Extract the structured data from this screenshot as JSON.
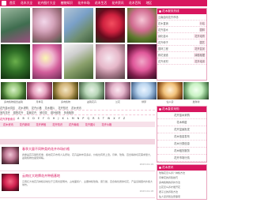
{
  "nav": {
    "items": [
      "首页",
      "花木大全",
      "花卉图片大全",
      "植物知识",
      "花卉市场",
      "花木生活",
      "花卉资讯",
      "花木百科",
      "地区"
    ]
  },
  "gallery": {
    "captions": [
      "",
      "",
      "",
      "",
      "",
      "",
      "",
      "",
      "",
      ""
    ]
  },
  "side_box": {
    "title": "花木服务热线",
    "rows": [
      {
        "left": "云南曲靖花卉市场",
        "right": ""
      },
      {
        "left": "花木直销",
        "right": "分站"
      },
      {
        "left": "花卉苗木",
        "right": "园林"
      },
      {
        "left": "绿化苗木",
        "right": "花卉培育"
      },
      {
        "left": "花卉种子",
        "right": "园艺"
      },
      {
        "left": "园林工程",
        "right": "花卉盆景"
      },
      {
        "left": "鲜花速递",
        "right": "绿植租摆"
      },
      {
        "left": "花卉资材",
        "right": "花卉培训"
      }
    ]
  },
  "thumbs": {
    "captions": [
      "多肉植物组合盆栽",
      "月季花",
      "多肉植物",
      "盆栽花卉",
      "兰花",
      "绿萝",
      "仙人掌",
      "发财树"
    ]
  },
  "links": {
    "line1": [
      "花卉苗木供应",
      "花木求购",
      "花卉价格",
      "花木图片",
      "花卉知识",
      "花木资讯"
    ],
    "line2": [
      "室内花卉",
      "庭院花卉",
      "盆栽花卉",
      "鲜切花",
      "观叶植物",
      "多肉植物"
    ],
    "alpha_label": "花卉拼音索引",
    "letters": [
      "A",
      "B",
      "C",
      "D",
      "E",
      "F",
      "G",
      "H",
      "J",
      "K",
      "L",
      "M",
      "N",
      "P",
      "Q",
      "R",
      "S",
      "T",
      "W",
      "X",
      "Y",
      "Z"
    ],
    "tabs": [
      "花木资讯",
      "花卉新闻",
      "花卉养殖",
      "花卉知识",
      "花卉栽培",
      "花卉图片",
      "花卉价格"
    ]
  },
  "right_col": {
    "panel1_title": "花木直供采购",
    "panel1_items": [
      "花卉苗木采购",
      "花木种苗",
      "花卉盆景批发",
      "花木信息发布",
      "花木分类信息",
      "花木租赁服务",
      "花卉市场行情"
    ],
    "panel2_title": "花木资讯",
    "panel2_items": [
      "玫瑰花怎么养？种植方法",
      "月季花的养殖技巧",
      "多肉植物的养护方法",
      "兰花怎么养才能开花",
      "君子兰的养殖方法",
      "仙人掌养殖注意事项"
    ]
  },
  "news": {
    "items": [
      {
        "title": "春季大量不同种类的花卉市场价格",
        "text": "春季是花卉销售旺季，各地花卉市场人头攒动，花卉品种丰富多彩，价格也有所上涨。月季、玫瑰、百合等鲜切花需求量大，盆栽植物也备受青睐。",
        "meta": "2023-04-19"
      },
      {
        "title": "云南红大地牌花卉种植基地",
        "text": "云南红大地花卉种植基地位于云南省昆明市，占地面积广，主要种植玫瑰、康乃馨、百合等优质鲜切花，产品远销国内外各大城市。",
        "meta": "2023-04-18"
      }
    ]
  }
}
